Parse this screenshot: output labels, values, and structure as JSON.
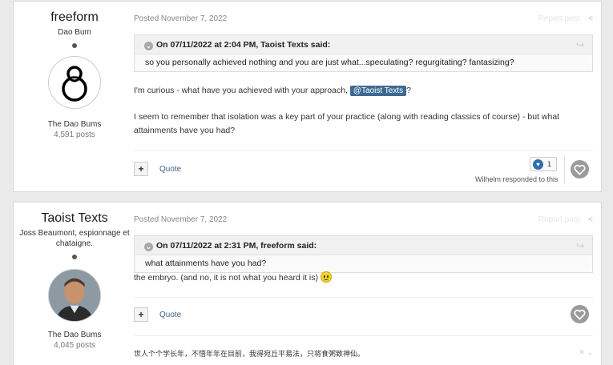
{
  "posts": [
    {
      "author": {
        "name": "freeform",
        "title": "Dao Bum",
        "group": "The Dao Bums",
        "posts_count": "4,591 posts"
      },
      "posted_label": "Posted",
      "posted_date": "November 7, 2022",
      "report_label": "Report post",
      "quote": {
        "header": "On 07/11/2022 at 2:04 PM, Taoist Texts said:",
        "body": "so you personally  achieved nothing and you are just what...speculating? regurgitating? fantasizing?"
      },
      "paragraph1_before": "I'm curious - what have you achieved with your approach,",
      "mention": "@Taoist Texts",
      "paragraph1_after": "?",
      "paragraph2": "I seem to remember that isolation was a key part of your practice (along with reading classics of course) - but what attainments have you had?",
      "multiquote_label": "+",
      "quote_label": "Quote",
      "reaction_count": "1",
      "responded_text": "Wilhelm responded to this"
    },
    {
      "author": {
        "name": "Taoist Texts",
        "title": "Joss Beaumont, espionnage et chataigne.",
        "group": "The Dao Bums",
        "posts_count": "4,045 posts"
      },
      "posted_label": "Posted",
      "posted_date": "November 7, 2022",
      "report_label": "Report post",
      "quote": {
        "header": "On 07/11/2022 at 2:31 PM, freeform said:",
        "body": "what attainments have you had?"
      },
      "paragraph1": "the embryo. (and no, it is not what you heard it is)",
      "multiquote_label": "+",
      "quote_label": "Quote",
      "signature": "世人个个学长年，不悟年年在目前，我得宛丘平易法，只将食粥致神仙。"
    }
  ],
  "colors": {
    "mention_bg": "#3d6a94",
    "like_heart": "#2e6fa8",
    "link": "#3d5f84"
  }
}
